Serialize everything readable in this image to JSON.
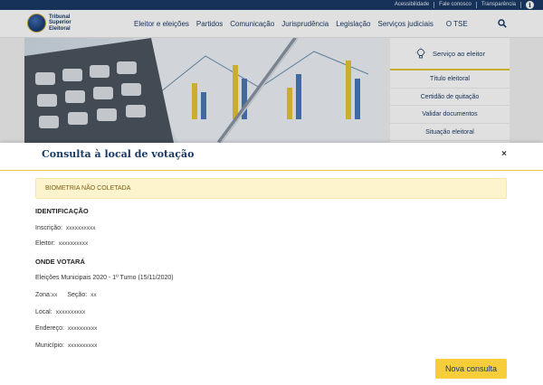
{
  "util_bar": {
    "links": [
      "Acessibilidade",
      "Fale conosco",
      "Transparência"
    ]
  },
  "header": {
    "logo_lines": [
      "Tribunal",
      "Superior",
      "Eleitoral"
    ],
    "nav": [
      "Eleitor e eleições",
      "Partidos",
      "Comunicação",
      "Jurisprudência",
      "Legislação",
      "Serviços judiciais",
      "O TSE"
    ]
  },
  "side_panel": {
    "title": "Serviço ao eleitor",
    "items": [
      "Título eleitoral",
      "Certidão de quitação",
      "Validar documentos",
      "Situação eleitoral"
    ]
  },
  "modal": {
    "title": "Consulta à local de votação",
    "close": "×",
    "alert": "BIOMETRIA NÃO COLETADA",
    "ident_heading": "IDENTIFICAÇÃO",
    "inscricao_label": "Inscrição:",
    "inscricao_value": "xxxxxxxxxx",
    "eleitor_label": "Eleitor:",
    "eleitor_value": "xxxxxxxxxx",
    "onde_heading": "ONDE VOTARÁ",
    "eleicao": "Eleições Municipais 2020 - 1º Turno (15/11/2020)",
    "zona_label": "Zona:",
    "zona_value": "xx",
    "secao_label": "Seção:",
    "secao_value": "xx",
    "local_label": "Local:",
    "local_value": "xxxxxxxxxx",
    "endereco_label": "Endereço:",
    "endereco_value": "xxxxxxxxxx",
    "municipio_label": "Município:",
    "municipio_value": "xxxxxxxxxx",
    "button": "Nova consulta"
  },
  "colors": {
    "navy": "#1a3a66",
    "gold": "#e8c534",
    "button": "#f7ce3a",
    "alert_bg": "#fdf3cd"
  }
}
